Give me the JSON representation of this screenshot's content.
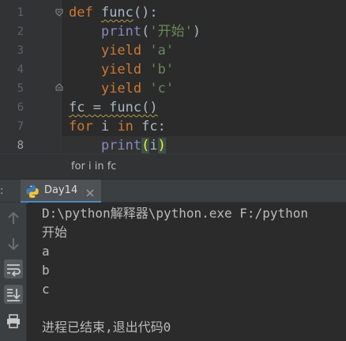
{
  "editor": {
    "line_numbers": [
      "1",
      "2",
      "3",
      "4",
      "5",
      "6",
      "7",
      "8"
    ],
    "lines": [
      {
        "parts": [
          {
            "t": "def ",
            "c": "kw"
          },
          {
            "t": "func",
            "c": "fn squiggle"
          },
          {
            "t": "():",
            "c": ""
          }
        ]
      },
      {
        "parts": [
          {
            "t": "    ",
            "c": ""
          },
          {
            "t": "print",
            "c": "bi"
          },
          {
            "t": "(",
            "c": ""
          },
          {
            "t": "'开始'",
            "c": "str"
          },
          {
            "t": ")",
            "c": ""
          }
        ]
      },
      {
        "parts": [
          {
            "t": "    ",
            "c": ""
          },
          {
            "t": "yield ",
            "c": "kw"
          },
          {
            "t": "'a'",
            "c": "str"
          }
        ]
      },
      {
        "parts": [
          {
            "t": "    ",
            "c": ""
          },
          {
            "t": "yield ",
            "c": "kw"
          },
          {
            "t": "'b'",
            "c": "str"
          }
        ]
      },
      {
        "parts": [
          {
            "t": "    ",
            "c": ""
          },
          {
            "t": "yield ",
            "c": "kw"
          },
          {
            "t": "'c'",
            "c": "str"
          }
        ]
      },
      {
        "parts": [
          {
            "t": "fc = func()",
            "c": "squiggle"
          }
        ]
      },
      {
        "parts": [
          {
            "t": "for ",
            "c": "kw"
          },
          {
            "t": "i ",
            "c": ""
          },
          {
            "t": "in ",
            "c": "kw"
          },
          {
            "t": "fc:",
            "c": ""
          }
        ]
      },
      {
        "parts": [
          {
            "t": "    ",
            "c": ""
          },
          {
            "t": "print",
            "c": "bi"
          },
          {
            "t": "(",
            "c": "brace-match"
          },
          {
            "t": "i",
            "c": ""
          },
          {
            "t": ")",
            "c": "brace-match"
          }
        ]
      }
    ]
  },
  "breadcrumb": {
    "text": "for i in fc"
  },
  "run_panel": {
    "prefix": ":",
    "tab_label": "Day14",
    "output": [
      "D:\\python解释器\\python.exe F:/python",
      "开始",
      "a",
      "b",
      "c",
      "",
      "进程已结束,退出代码0"
    ]
  },
  "colors": {
    "background": "#2b2b2b",
    "keyword": "#cc7832",
    "string": "#6a8759",
    "builtin": "#8888c6",
    "text": "#a9b7c6",
    "tab_accent": "#4a88c7"
  },
  "icons": {
    "run_tab": "python-icon",
    "tab_close": "close-icon",
    "toolbar": [
      "arrow-up-icon",
      "arrow-down-icon",
      "soft-wrap-icon",
      "scroll-to-end-icon",
      "print-icon"
    ]
  }
}
